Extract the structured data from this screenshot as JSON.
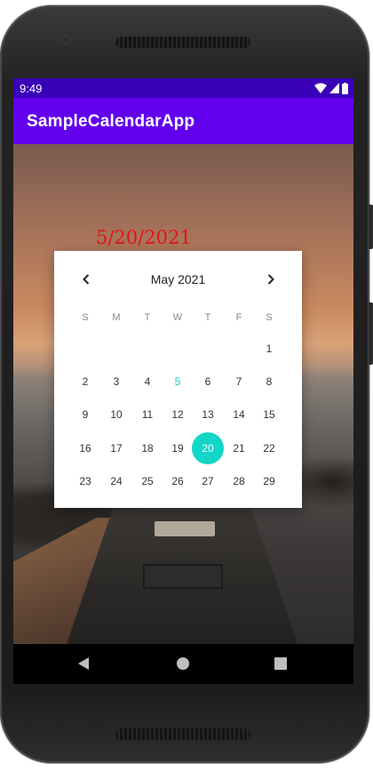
{
  "status_bar": {
    "time": "9:49"
  },
  "app_bar": {
    "title": "SampleCalendarApp"
  },
  "selected_date_text": "5/20/2021",
  "calendar": {
    "month_label": "May 2021",
    "weekdays": [
      "S",
      "M",
      "T",
      "W",
      "T",
      "F",
      "S"
    ],
    "weeks": [
      [
        "",
        "",
        "",
        "",
        "",
        "",
        "1"
      ],
      [
        "2",
        "3",
        "4",
        "5",
        "6",
        "7",
        "8"
      ],
      [
        "9",
        "10",
        "11",
        "12",
        "13",
        "14",
        "15"
      ],
      [
        "16",
        "17",
        "18",
        "19",
        "20",
        "21",
        "22"
      ],
      [
        "23",
        "24",
        "25",
        "26",
        "27",
        "28",
        "29"
      ]
    ],
    "today": "5",
    "selected": "20",
    "today_color": "#19c9c1",
    "selected_color": "#12d6c6"
  },
  "colors": {
    "status_bar": "#3a00b8",
    "app_bar": "#6200ee",
    "date_text": "#e0141b"
  },
  "icons": {
    "prev_month": "chevron-left-icon",
    "next_month": "chevron-right-icon",
    "nav_back": "back-triangle-icon",
    "nav_home": "home-circle-icon",
    "nav_recents": "recents-square-icon"
  }
}
